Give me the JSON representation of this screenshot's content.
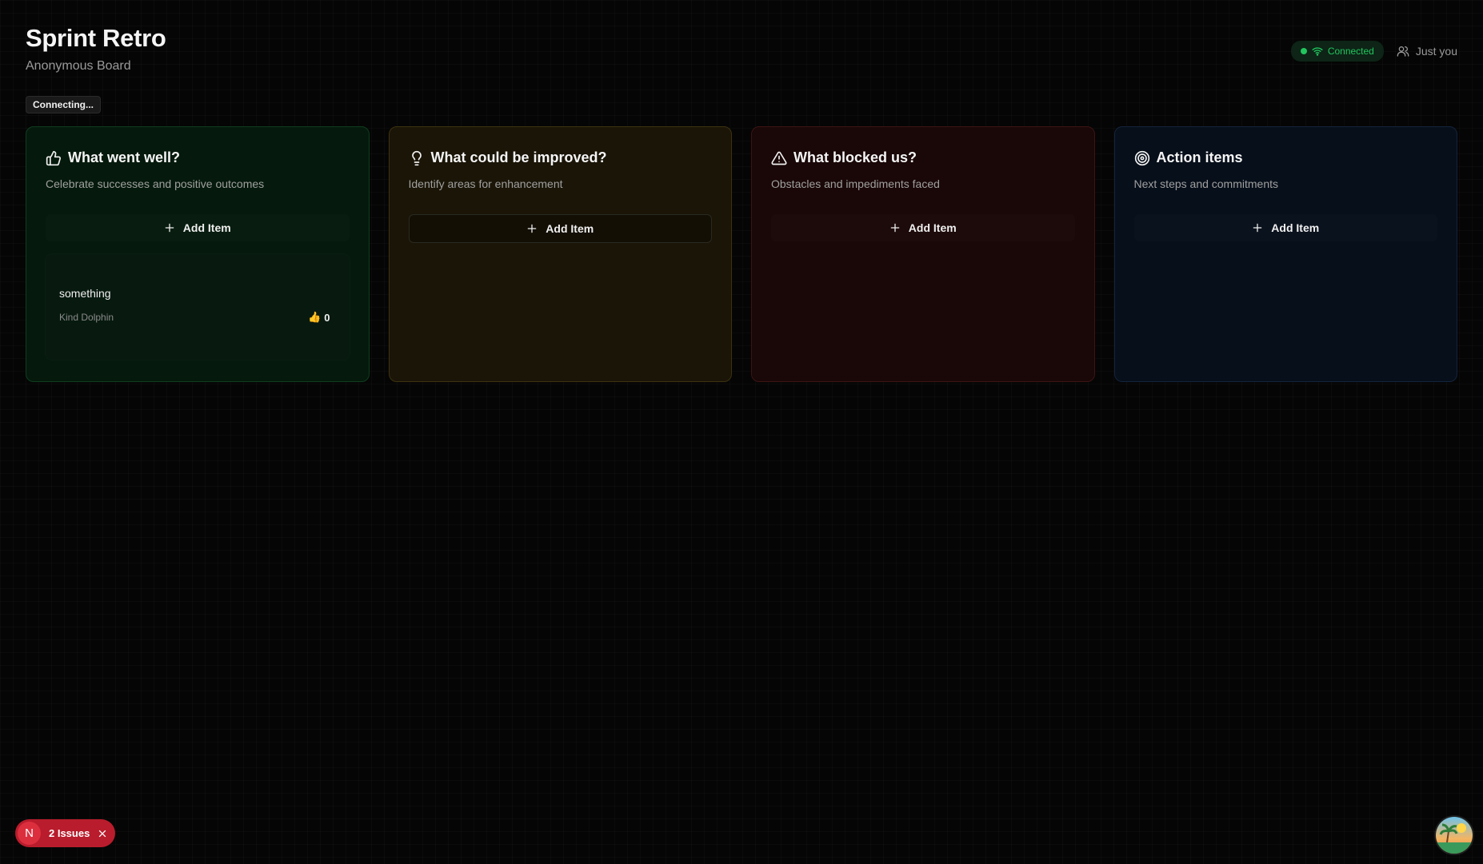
{
  "header": {
    "title": "Sprint Retro",
    "subtitle": "Anonymous Board"
  },
  "status": {
    "connection_label": "Connected",
    "users_label": "Just you",
    "connecting_label": "Connecting..."
  },
  "columns": [
    {
      "title": "What went well?",
      "description": "Celebrate successes and positive outcomes",
      "add_label": "Add Item",
      "icon": "thumbs-up-icon",
      "items": [
        {
          "text": "something",
          "author": "Kind Dolphin",
          "votes": "0"
        }
      ]
    },
    {
      "title": "What could be improved?",
      "description": "Identify areas for enhancement",
      "add_label": "Add Item",
      "icon": "lightbulb-icon",
      "items": []
    },
    {
      "title": "What blocked us?",
      "description": "Obstacles and impediments faced",
      "add_label": "Add Item",
      "icon": "warning-triangle-icon",
      "items": []
    },
    {
      "title": "Action items",
      "description": "Next steps and commitments",
      "add_label": "Add Item",
      "icon": "target-icon",
      "items": []
    }
  ],
  "dev_overlay": {
    "badge_letter": "N",
    "issues_label": "2 Issues"
  },
  "colors": {
    "connected": "#22c55e",
    "issues_bg": "#b91c2c",
    "col_green": "#051a0c",
    "col_yellow": "#1a1507",
    "col_red": "#1a0707",
    "col_blue": "#070f1a"
  }
}
